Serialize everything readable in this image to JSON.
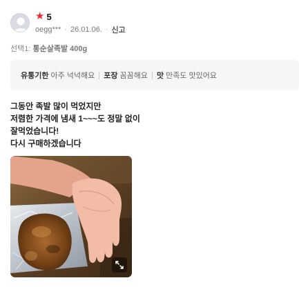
{
  "review": {
    "rating": "5",
    "user": "oegg***",
    "date": "26.01.06.",
    "report_label": "신고",
    "option_prefix": "선택1:",
    "option_name": "통순살족발 400g",
    "tags": [
      {
        "key": "유통기한",
        "value": "아주 넉넉해요"
      },
      {
        "key": "포장",
        "value": "꼼꼼해요"
      },
      {
        "key": "맛",
        "value": "만족도 맛있어요"
      }
    ],
    "text_lines": [
      "그동안 족발 많이 먹었지만",
      "저렴한 가격에 냄새 1~~~도 정말 없이",
      "잘먹었습니다!",
      "다시 구매하겠습니다"
    ]
  },
  "icons": {
    "star": "star-icon",
    "avatar": "default-avatar-icon",
    "expand": "expand-icon"
  },
  "colors": {
    "star": "#f0262f",
    "tag_background": "#f5f6f8"
  }
}
